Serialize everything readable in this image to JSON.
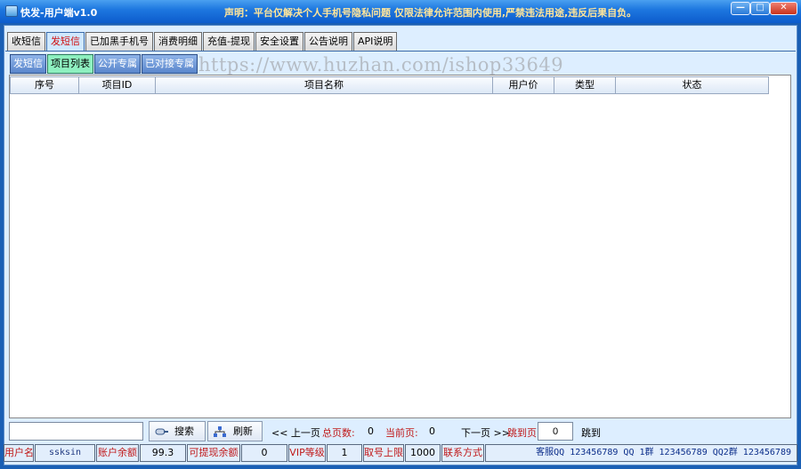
{
  "window": {
    "title": "快发-用户端v1.0",
    "notice": "声明：平台仅解决个人手机号隐私问题 仅限法律允许范围内使用,严禁违法用途,违反后果自负。",
    "controls": {
      "minimize": "—",
      "maximize": "□",
      "close": "✕"
    }
  },
  "tabs": [
    {
      "label": "收短信"
    },
    {
      "label": "发短信"
    },
    {
      "label": "已加黑手机号"
    },
    {
      "label": "消费明细"
    },
    {
      "label": "充值-提现"
    },
    {
      "label": "安全设置"
    },
    {
      "label": "公告说明"
    },
    {
      "label": "API说明"
    }
  ],
  "subtabs": [
    {
      "label": "发短信"
    },
    {
      "label": "项目列表"
    },
    {
      "label": "公开专属"
    },
    {
      "label": "已对接专属"
    }
  ],
  "watermark": "https://www.huzhan.com/ishop33649",
  "table": {
    "columns": [
      "序号",
      "项目ID",
      "项目名称",
      "用户价",
      "类型",
      "状态"
    ],
    "rows": []
  },
  "controls": {
    "search_value": "",
    "search_label": "搜索",
    "refresh_label": "刷新",
    "prev_label": "<< 上一页",
    "total_pages_label": "总页数:",
    "total_pages_value": "0",
    "current_page_label": "当前页:",
    "current_page_value": "0",
    "next_label": "下一页 >>",
    "goto_label": "跳到页",
    "goto_value": "0",
    "jump_label": "跳到"
  },
  "status": {
    "username_label": "用户名",
    "username_value": "ssksin",
    "balance_label": "账户余额",
    "balance_value": "99.3",
    "withdrawable_label": "可提现余额",
    "withdrawable_value": "0",
    "vip_label": "VIP等级",
    "vip_value": "1",
    "limit_label": "取号上限",
    "limit_value": "1000",
    "contact_label": "联系方式",
    "contact_value": "客服QQ 123456789 QQ 1群 123456789 QQ2群 123456789"
  },
  "colors": {
    "titlebar": "#1e78e0",
    "active_tab_text": "#d01010",
    "active_subtab_bg": "#8ef0c0",
    "label_red": "#c01818",
    "notice_text": "#ffe59a"
  }
}
